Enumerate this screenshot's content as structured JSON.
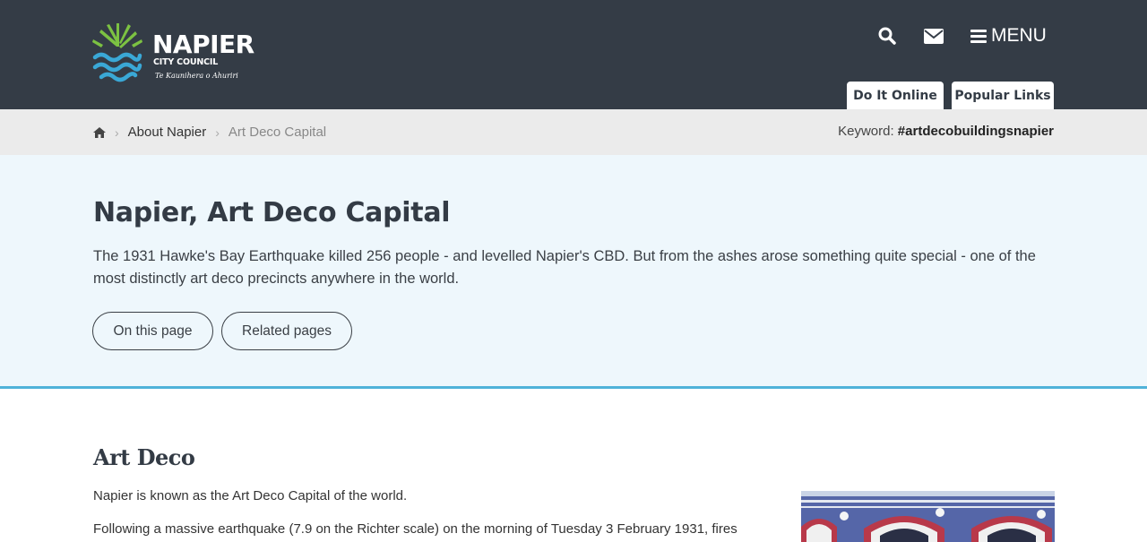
{
  "header": {
    "logo": {
      "name": "NAPIER",
      "subtitle": "CITY COUNCIL",
      "tagline": "Te Kaunihera o Ahuriri"
    },
    "menu_label": "MENU",
    "icons": [
      "search-icon",
      "envelope-icon",
      "hamburger-icon"
    ],
    "tabs": [
      {
        "label": "Do It Online",
        "accent": "#3aa8d6"
      },
      {
        "label": "Popular Links",
        "accent": "#7cc242"
      }
    ],
    "background": "#343c46"
  },
  "breadcrumb": {
    "items": [
      "About Napier",
      "Art Deco Capital"
    ],
    "keyword_label": "Keyword:",
    "keyword_value": "#artdecobuildingsnapier"
  },
  "hero": {
    "title": "Napier, Art Deco Capital",
    "intro": "The 1931 Hawke's Bay Earthquake killed 256 people - and levelled Napier's CBD. But from the ashes arose something quite special - one of the most distinctly art deco precincts anywhere in the world.",
    "buttons": [
      "On this page",
      "Related pages"
    ],
    "background": "#eef7fc",
    "accent": "#4fb2d9"
  },
  "content": {
    "section_title": "Art Deco",
    "paragraphs": [
      "Napier is known as the Art Deco Capital of the world.",
      "Following a massive earthquake (7.9 on the Richter scale) on the morning of Tuesday 3 February 1931, fires"
    ]
  }
}
